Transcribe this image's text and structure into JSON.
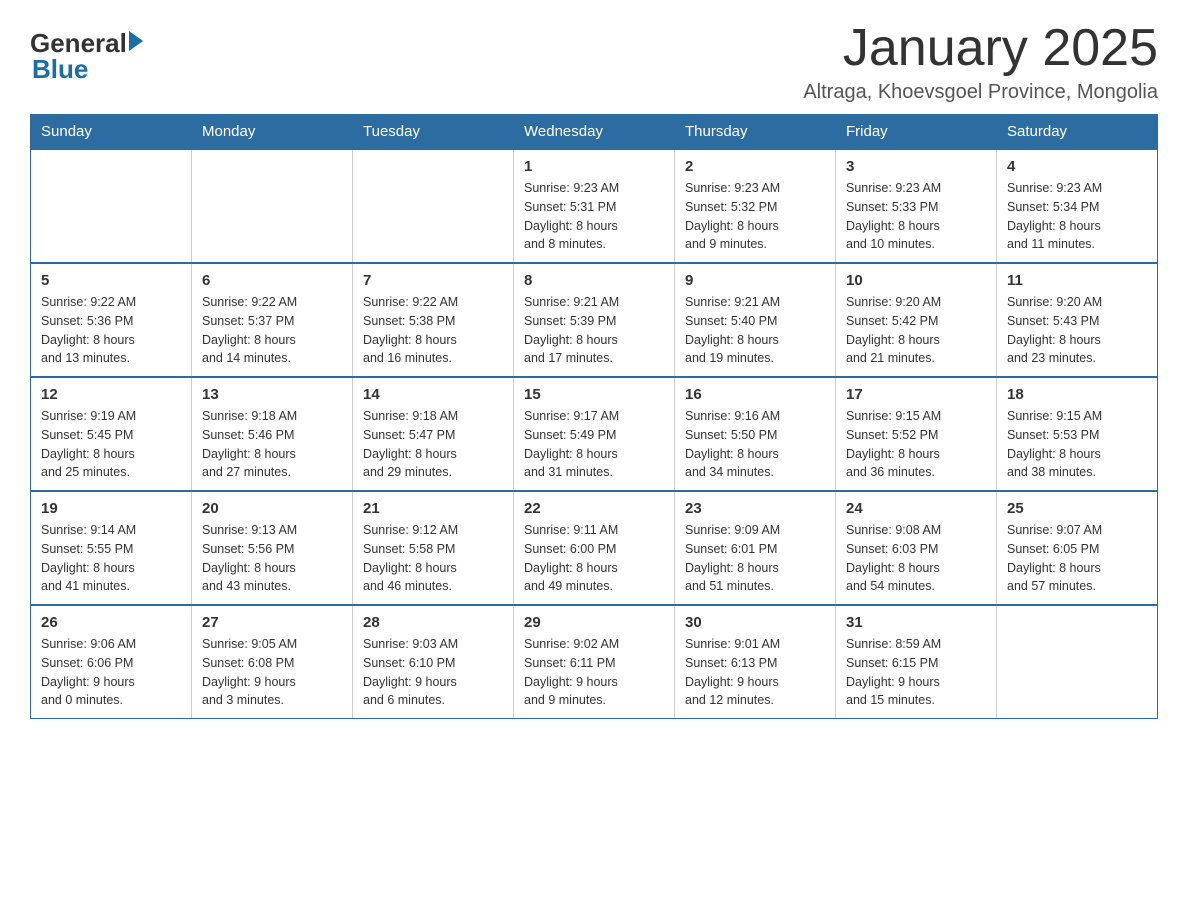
{
  "logo": {
    "text_general": "General",
    "text_blue": "Blue"
  },
  "title": "January 2025",
  "subtitle": "Altraga, Khoevsgoel Province, Mongolia",
  "header_days": [
    "Sunday",
    "Monday",
    "Tuesday",
    "Wednesday",
    "Thursday",
    "Friday",
    "Saturday"
  ],
  "weeks": [
    [
      {
        "day": "",
        "info": ""
      },
      {
        "day": "",
        "info": ""
      },
      {
        "day": "",
        "info": ""
      },
      {
        "day": "1",
        "info": "Sunrise: 9:23 AM\nSunset: 5:31 PM\nDaylight: 8 hours\nand 8 minutes."
      },
      {
        "day": "2",
        "info": "Sunrise: 9:23 AM\nSunset: 5:32 PM\nDaylight: 8 hours\nand 9 minutes."
      },
      {
        "day": "3",
        "info": "Sunrise: 9:23 AM\nSunset: 5:33 PM\nDaylight: 8 hours\nand 10 minutes."
      },
      {
        "day": "4",
        "info": "Sunrise: 9:23 AM\nSunset: 5:34 PM\nDaylight: 8 hours\nand 11 minutes."
      }
    ],
    [
      {
        "day": "5",
        "info": "Sunrise: 9:22 AM\nSunset: 5:36 PM\nDaylight: 8 hours\nand 13 minutes."
      },
      {
        "day": "6",
        "info": "Sunrise: 9:22 AM\nSunset: 5:37 PM\nDaylight: 8 hours\nand 14 minutes."
      },
      {
        "day": "7",
        "info": "Sunrise: 9:22 AM\nSunset: 5:38 PM\nDaylight: 8 hours\nand 16 minutes."
      },
      {
        "day": "8",
        "info": "Sunrise: 9:21 AM\nSunset: 5:39 PM\nDaylight: 8 hours\nand 17 minutes."
      },
      {
        "day": "9",
        "info": "Sunrise: 9:21 AM\nSunset: 5:40 PM\nDaylight: 8 hours\nand 19 minutes."
      },
      {
        "day": "10",
        "info": "Sunrise: 9:20 AM\nSunset: 5:42 PM\nDaylight: 8 hours\nand 21 minutes."
      },
      {
        "day": "11",
        "info": "Sunrise: 9:20 AM\nSunset: 5:43 PM\nDaylight: 8 hours\nand 23 minutes."
      }
    ],
    [
      {
        "day": "12",
        "info": "Sunrise: 9:19 AM\nSunset: 5:45 PM\nDaylight: 8 hours\nand 25 minutes."
      },
      {
        "day": "13",
        "info": "Sunrise: 9:18 AM\nSunset: 5:46 PM\nDaylight: 8 hours\nand 27 minutes."
      },
      {
        "day": "14",
        "info": "Sunrise: 9:18 AM\nSunset: 5:47 PM\nDaylight: 8 hours\nand 29 minutes."
      },
      {
        "day": "15",
        "info": "Sunrise: 9:17 AM\nSunset: 5:49 PM\nDaylight: 8 hours\nand 31 minutes."
      },
      {
        "day": "16",
        "info": "Sunrise: 9:16 AM\nSunset: 5:50 PM\nDaylight: 8 hours\nand 34 minutes."
      },
      {
        "day": "17",
        "info": "Sunrise: 9:15 AM\nSunset: 5:52 PM\nDaylight: 8 hours\nand 36 minutes."
      },
      {
        "day": "18",
        "info": "Sunrise: 9:15 AM\nSunset: 5:53 PM\nDaylight: 8 hours\nand 38 minutes."
      }
    ],
    [
      {
        "day": "19",
        "info": "Sunrise: 9:14 AM\nSunset: 5:55 PM\nDaylight: 8 hours\nand 41 minutes."
      },
      {
        "day": "20",
        "info": "Sunrise: 9:13 AM\nSunset: 5:56 PM\nDaylight: 8 hours\nand 43 minutes."
      },
      {
        "day": "21",
        "info": "Sunrise: 9:12 AM\nSunset: 5:58 PM\nDaylight: 8 hours\nand 46 minutes."
      },
      {
        "day": "22",
        "info": "Sunrise: 9:11 AM\nSunset: 6:00 PM\nDaylight: 8 hours\nand 49 minutes."
      },
      {
        "day": "23",
        "info": "Sunrise: 9:09 AM\nSunset: 6:01 PM\nDaylight: 8 hours\nand 51 minutes."
      },
      {
        "day": "24",
        "info": "Sunrise: 9:08 AM\nSunset: 6:03 PM\nDaylight: 8 hours\nand 54 minutes."
      },
      {
        "day": "25",
        "info": "Sunrise: 9:07 AM\nSunset: 6:05 PM\nDaylight: 8 hours\nand 57 minutes."
      }
    ],
    [
      {
        "day": "26",
        "info": "Sunrise: 9:06 AM\nSunset: 6:06 PM\nDaylight: 9 hours\nand 0 minutes."
      },
      {
        "day": "27",
        "info": "Sunrise: 9:05 AM\nSunset: 6:08 PM\nDaylight: 9 hours\nand 3 minutes."
      },
      {
        "day": "28",
        "info": "Sunrise: 9:03 AM\nSunset: 6:10 PM\nDaylight: 9 hours\nand 6 minutes."
      },
      {
        "day": "29",
        "info": "Sunrise: 9:02 AM\nSunset: 6:11 PM\nDaylight: 9 hours\nand 9 minutes."
      },
      {
        "day": "30",
        "info": "Sunrise: 9:01 AM\nSunset: 6:13 PM\nDaylight: 9 hours\nand 12 minutes."
      },
      {
        "day": "31",
        "info": "Sunrise: 8:59 AM\nSunset: 6:15 PM\nDaylight: 9 hours\nand 15 minutes."
      },
      {
        "day": "",
        "info": ""
      }
    ]
  ]
}
